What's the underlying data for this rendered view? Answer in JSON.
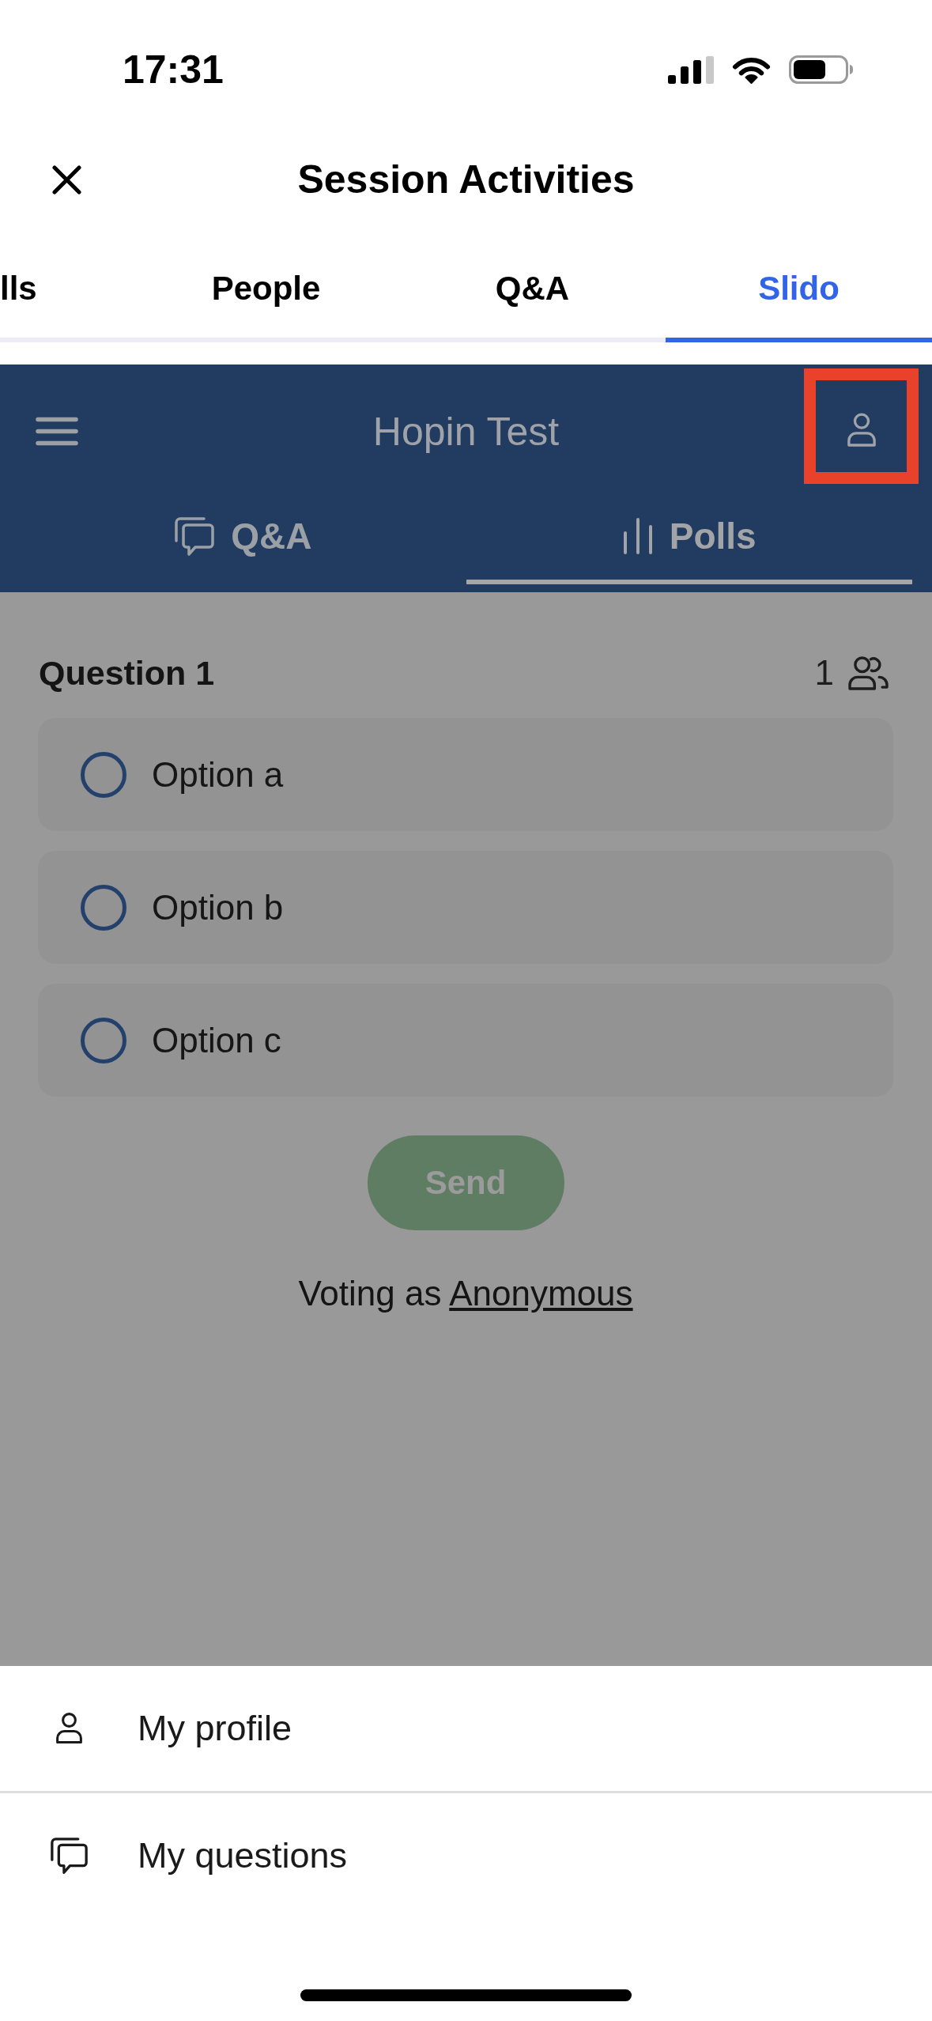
{
  "status_bar": {
    "time": "17:31"
  },
  "header": {
    "title": "Session Activities"
  },
  "tabs": [
    {
      "label": "lls",
      "selected": false
    },
    {
      "label": "People",
      "selected": false
    },
    {
      "label": "Q&A",
      "selected": false
    },
    {
      "label": "Slido",
      "selected": true
    }
  ],
  "slido": {
    "title": "Hopin Test",
    "profile_highlighted": true,
    "tabs": [
      {
        "kind": "questions",
        "label": "Q&A",
        "selected": false
      },
      {
        "kind": "polls",
        "label": "Polls",
        "selected": true
      }
    ]
  },
  "poll": {
    "question": "Question 1",
    "voters": "1",
    "options": [
      {
        "label": "Option a",
        "selected": false
      },
      {
        "label": "Option b",
        "selected": false
      },
      {
        "label": "Option c",
        "selected": false
      }
    ],
    "send_label": "Send",
    "voting_text": "Voting as",
    "voting_link": "Anonymous"
  },
  "menu": {
    "items": [
      {
        "kind": "profile",
        "label": "My profile"
      },
      {
        "kind": "questions",
        "label": "My questions"
      }
    ]
  }
}
